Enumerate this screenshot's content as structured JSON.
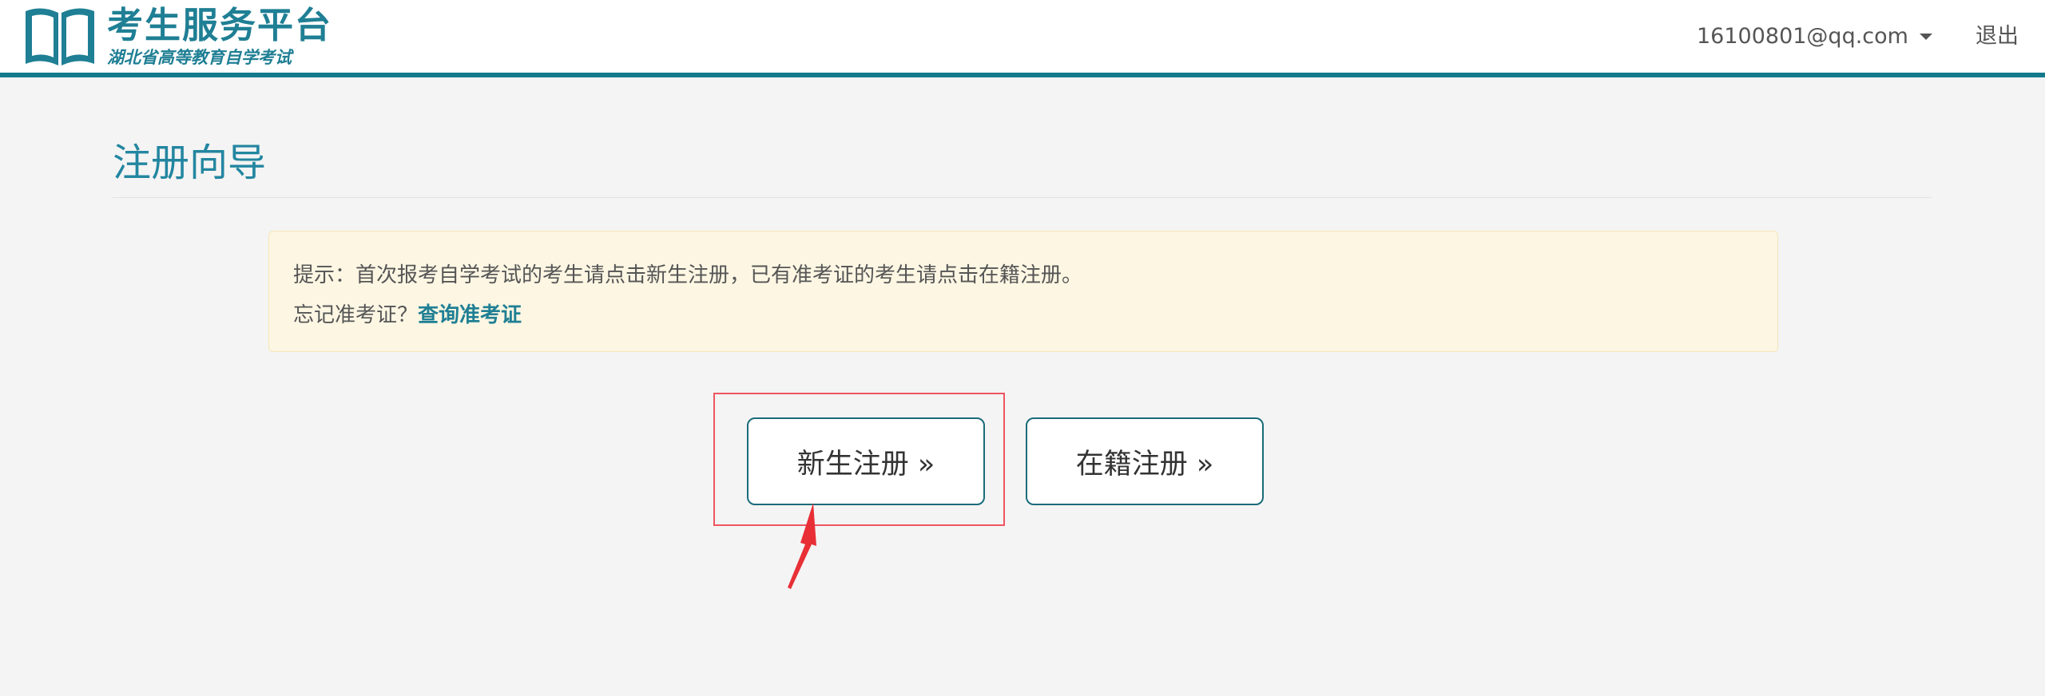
{
  "header": {
    "logo_title": "考生服务平台",
    "logo_subtitle": "湖北省高等教育自学考试",
    "user_email": "16100801@qq.com",
    "logout_label": "退出"
  },
  "page": {
    "title": "注册向导"
  },
  "notice": {
    "line1": "提示：首次报考自学考试的考生请点击新生注册，已有准考证的考生请点击在籍注册。",
    "line2_prefix": "忘记准考证？",
    "line2_link": "查询准考证"
  },
  "buttons": {
    "new_register": "新生注册 »",
    "existing_register": "在籍注册 »"
  },
  "colors": {
    "brand": "#137a8d",
    "title": "#2386a0",
    "notice_bg": "#fcf6e3",
    "highlight": "#ee5560"
  },
  "icons": {
    "logo": "open-book-icon",
    "user_menu_caret": "caret-down-icon",
    "annotation": "red-arrow-icon"
  }
}
